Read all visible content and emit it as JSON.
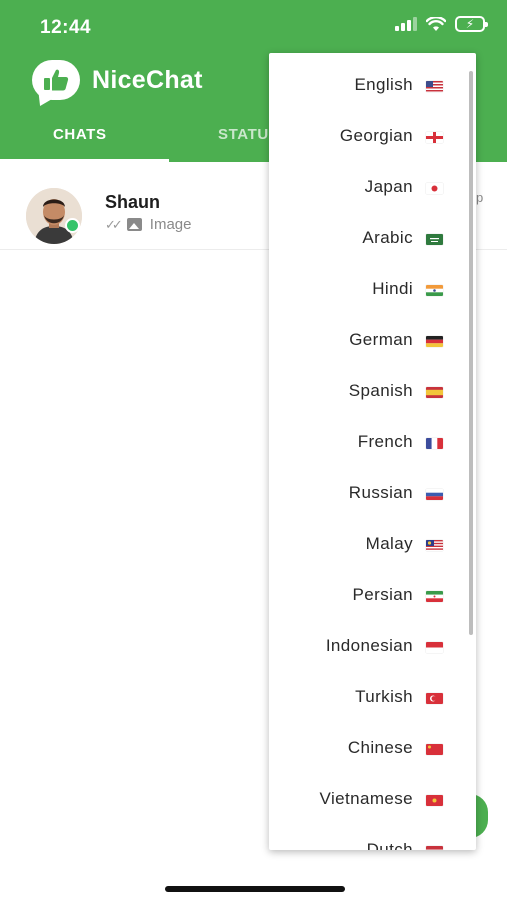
{
  "status_bar": {
    "time": "12:44"
  },
  "app": {
    "title": "NiceChat",
    "brand_color": "#4caf50"
  },
  "tabs": [
    {
      "label": "CHATS",
      "active": true
    },
    {
      "label": "STATUS",
      "active": false
    }
  ],
  "chats": [
    {
      "name": "Shaun",
      "preview": "Image",
      "online": true,
      "time_fragment": "p"
    }
  ],
  "language_menu": {
    "items": [
      {
        "label": "English",
        "flag": "us-flag"
      },
      {
        "label": "Georgian",
        "flag": "georgia-flag"
      },
      {
        "label": "Japan",
        "flag": "japan-flag"
      },
      {
        "label": "Arabic",
        "flag": "saudi-flag"
      },
      {
        "label": "Hindi",
        "flag": "india-flag"
      },
      {
        "label": "German",
        "flag": "germany-flag"
      },
      {
        "label": "Spanish",
        "flag": "spain-flag"
      },
      {
        "label": "French",
        "flag": "france-flag"
      },
      {
        "label": "Russian",
        "flag": "russia-flag"
      },
      {
        "label": "Malay",
        "flag": "malaysia-flag"
      },
      {
        "label": "Persian",
        "flag": "iran-flag"
      },
      {
        "label": "Indonesian",
        "flag": "indonesia-flag"
      },
      {
        "label": "Turkish",
        "flag": "turkey-flag"
      },
      {
        "label": "Chinese",
        "flag": "china-flag"
      },
      {
        "label": "Vietnamese",
        "flag": "vietnam-flag"
      },
      {
        "label": "Dutch",
        "flag": "netherlands-flag"
      }
    ]
  }
}
